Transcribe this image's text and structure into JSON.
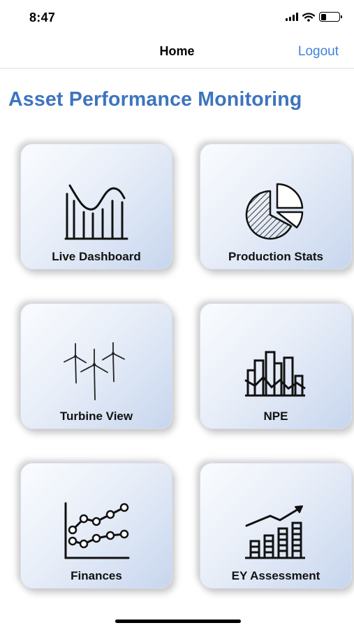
{
  "status_bar": {
    "time": "8:47"
  },
  "nav": {
    "title": "Home",
    "logout_label": "Logout"
  },
  "page": {
    "title": "Asset Performance Monitoring"
  },
  "colors": {
    "title_blue": "#3d74be",
    "link_blue": "#3f82db"
  },
  "tiles": [
    {
      "label": "Live Dashboard",
      "icon": "live-dashboard-chart-icon"
    },
    {
      "label": "Production Stats",
      "icon": "pie-chart-icon"
    },
    {
      "label": "Turbine View",
      "icon": "wind-turbines-icon"
    },
    {
      "label": "NPE",
      "icon": "bar-line-chart-icon"
    },
    {
      "label": "Finances",
      "icon": "line-graph-icon"
    },
    {
      "label": "EY Assessment",
      "icon": "trend-bar-chart-icon"
    }
  ]
}
